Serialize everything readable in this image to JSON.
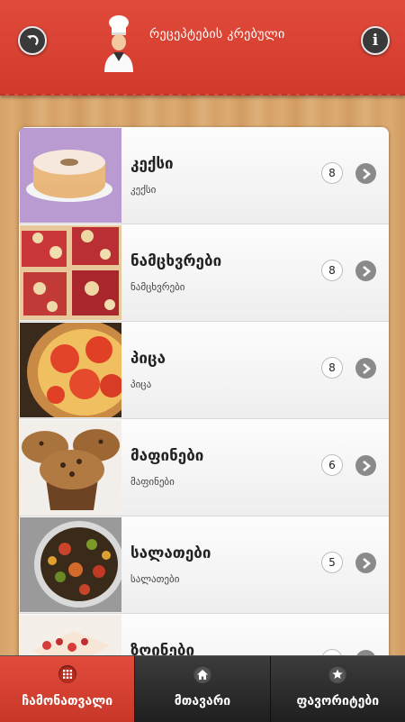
{
  "header": {
    "title": "რეცეპტების კრებული",
    "back_icon": "back-arrow-icon",
    "info_icon": "info-icon",
    "info_glyph": "i",
    "logo_icon": "chef-icon"
  },
  "recipes": [
    {
      "title": "კექსი",
      "subtitle": "კექსი",
      "count": "8",
      "image": "bundt-cake"
    },
    {
      "title": "ნამცხვრები",
      "subtitle": "ნამცხვრები",
      "count": "8",
      "image": "crumble-bars"
    },
    {
      "title": "პიცა",
      "subtitle": "პიცა",
      "count": "8",
      "image": "pizza"
    },
    {
      "title": "მაფინები",
      "subtitle": "მაფინები",
      "count": "6",
      "image": "muffins"
    },
    {
      "title": "სალათები",
      "subtitle": "სალათები",
      "count": "5",
      "image": "salad"
    },
    {
      "title": "ზღინები",
      "subtitle": "",
      "count": "",
      "image": "dessert"
    }
  ],
  "tabs": [
    {
      "label": "ჩამონათვალი",
      "icon": "grid-icon",
      "active": true
    },
    {
      "label": "მთავარი",
      "icon": "home-icon",
      "active": false
    },
    {
      "label": "ფავორიტები",
      "icon": "star-icon",
      "active": false
    }
  ],
  "colors": {
    "header_red": "#d9402f",
    "tabbar_dark": "#2a2a2a",
    "arrow_grey": "#8a8a8a"
  }
}
